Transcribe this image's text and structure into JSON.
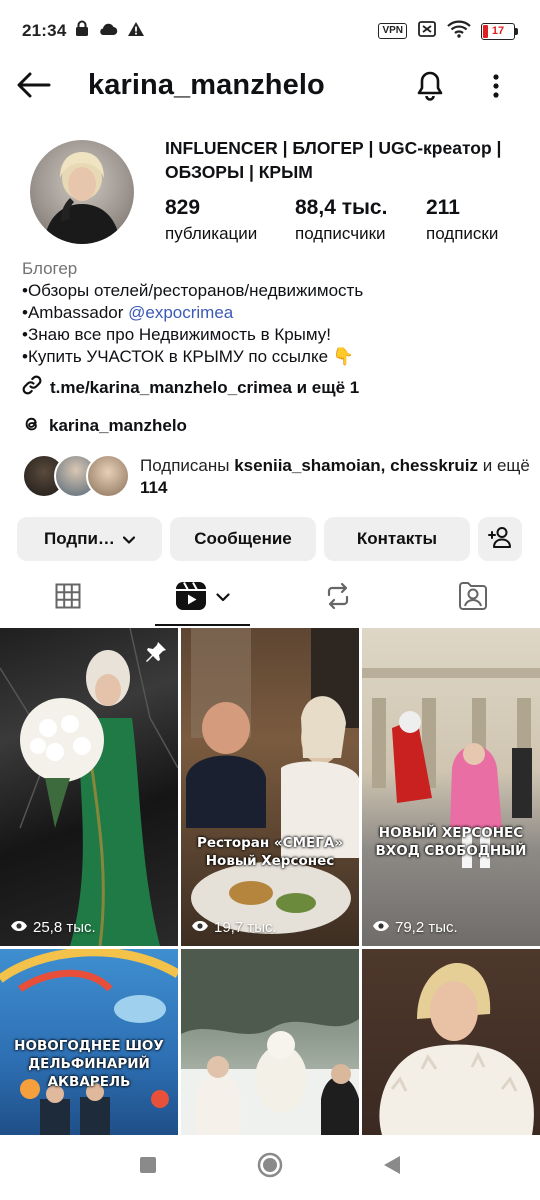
{
  "status_bar": {
    "time": "21:34",
    "vpn_label": "VPN",
    "battery_level": "17",
    "battery_fraction": 0.17,
    "icons": [
      "lock-icon",
      "cloud-icon",
      "warning-icon",
      "vpn-icon",
      "no-sim-icon",
      "wifi-icon",
      "battery-icon"
    ]
  },
  "header": {
    "username": "karina_manzhelo",
    "icons": [
      "back-arrow-icon",
      "bell-icon",
      "more-vertical-icon"
    ]
  },
  "profile": {
    "headline": "INFLUENCER | БЛОГЕР | UGC-креатор | ОБЗОРЫ | КРЫМ",
    "stats": [
      {
        "value": "829",
        "label": "публикации"
      },
      {
        "value": "88,4 тыс.",
        "label": "подписчики"
      },
      {
        "value": "211",
        "label": "подписки"
      }
    ],
    "category": "Блогер",
    "bio_lines": [
      "•Обзоры отелей/ресторанов/недвижимость",
      "•Ambassador ",
      "•Знаю все про Недвижимость в Крыму!",
      "•Купить УЧАСТОК в КРЫМУ по ссылке 👇"
    ],
    "mention": "@expocrimea",
    "link": "t.me/karina_manzhelo_crimea и ещё 1",
    "threads_handle": "karina_manzhelo"
  },
  "followed_by": {
    "prefix": "Подписаны ",
    "names": "kseniia_shamoian, chesskruiz",
    "suffix_prefix": " и ещё ",
    "count": "114"
  },
  "actions": {
    "follow_label": "Подпи…",
    "message_label": "Сообщение",
    "contacts_label": "Контакты"
  },
  "tabs": [
    "grid-tab",
    "reels-tab",
    "reposts-tab",
    "tagged-tab"
  ],
  "posts": [
    {
      "views": "25,8 тыс.",
      "overlay": "",
      "pinned": true
    },
    {
      "views": "19,7 тыс.",
      "overlay": "Ресторан «СМЕГА»\nНовый Херсонес",
      "pinned": false
    },
    {
      "views": "79,2 тыс.",
      "overlay": "НОВЫЙ ХЕРСОНЕС\nВХОД СВОБОДНЫЙ",
      "pinned": false
    },
    {
      "views": "",
      "overlay": "НОВОГОДНЕЕ ШОУ\nДЕЛЬФИНАРИЙ АКВАРЕЛЬ",
      "pinned": false
    },
    {
      "views": "",
      "overlay": "",
      "pinned": false
    },
    {
      "views": "",
      "overlay": "",
      "pinned": false
    }
  ],
  "colors": {
    "button_bg": "#efefef",
    "mention": "#3b5ab8",
    "battery_low": "#e02020"
  }
}
